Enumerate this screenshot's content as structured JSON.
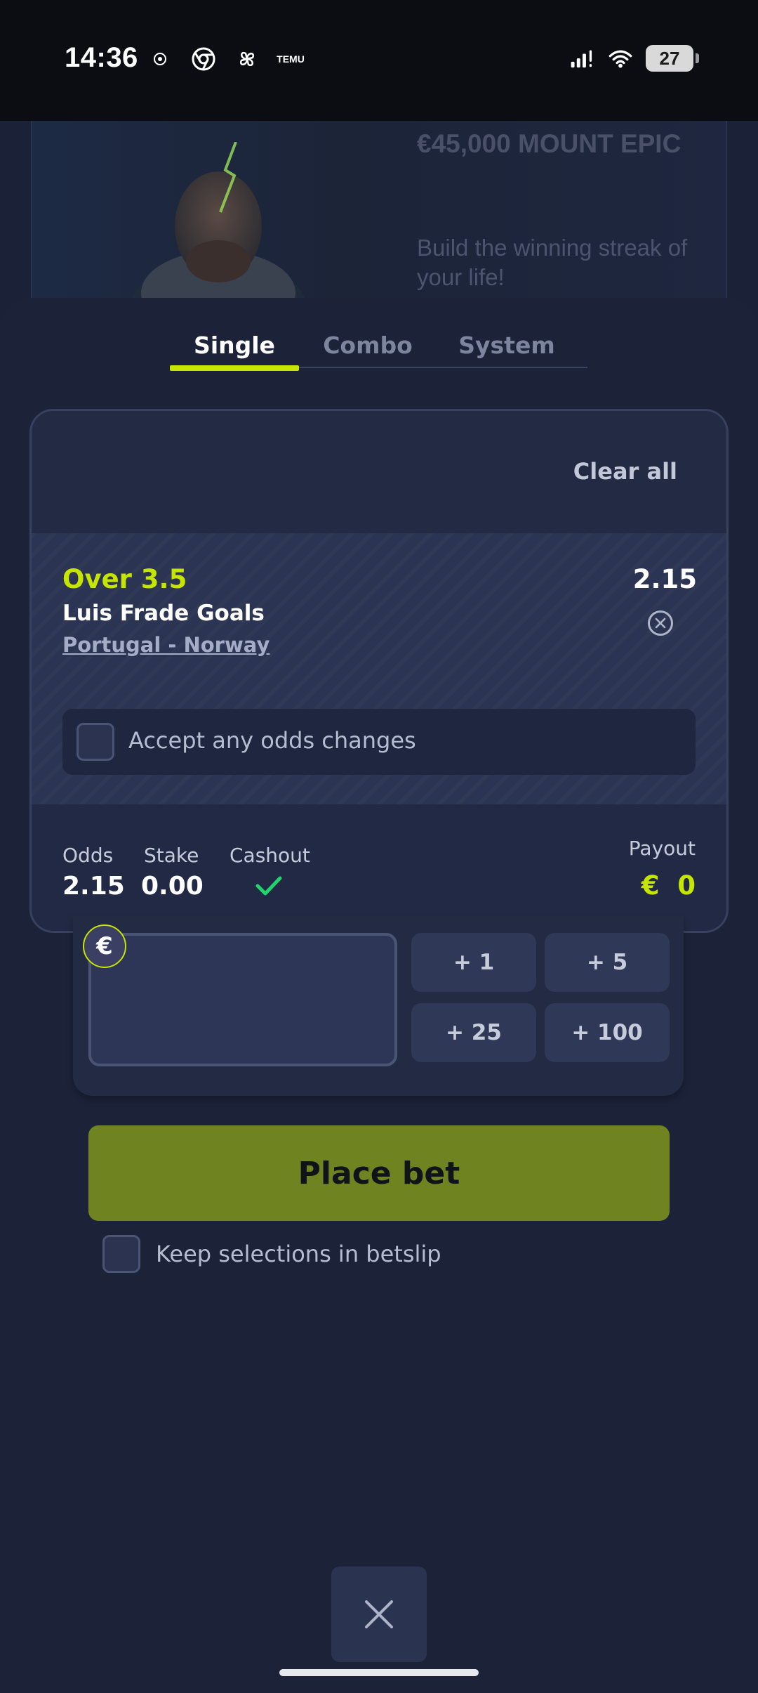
{
  "status_bar": {
    "time": "14:36",
    "left_icons": [
      "vpn-key-icon",
      "chrome-icon",
      "pinwheel-app-icon",
      "temu-icon"
    ],
    "temu_label": "TEMU",
    "battery": "27"
  },
  "banner": {
    "title": "€45,000 MOUNT EPIC",
    "subtitle": "Build the winning streak of your life!"
  },
  "tabs": [
    {
      "label": "Single",
      "active": true
    },
    {
      "label": "Combo",
      "active": false
    },
    {
      "label": "System",
      "active": false
    }
  ],
  "card": {
    "clear_all": "Clear all",
    "selection": {
      "market": "Over 3.5",
      "name": "Luis Frade Goals",
      "event": "Portugal - Norway",
      "odds": "2.15"
    },
    "accept_label": "Accept any odds changes",
    "summary": {
      "odds_label": "Odds",
      "odds_value": "2.15",
      "stake_label": "Stake",
      "stake_value": "0.00",
      "cashout_label": "Cashout",
      "payout_label": "Payout",
      "payout_currency": "€",
      "payout_value": "0"
    }
  },
  "stake": {
    "currency": "€",
    "input_value": "",
    "quick_buttons": [
      "+ 1",
      "+ 5",
      "+ 25",
      "+ 100"
    ]
  },
  "place_bet": "Place bet",
  "keep_label": "Keep selections in betslip",
  "colors": {
    "accent": "#c6e500",
    "place_bet_bg": "#6f8420",
    "sheet_bg": "#1c2339",
    "cashout_check": "#22d36b"
  }
}
